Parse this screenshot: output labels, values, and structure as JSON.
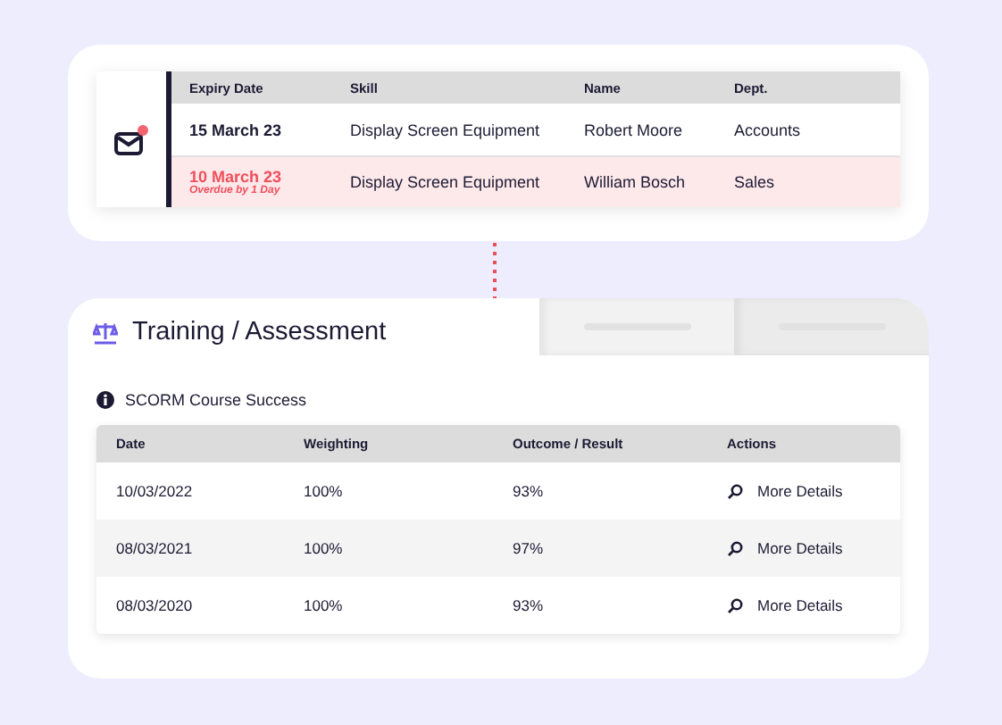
{
  "notification": {
    "unread": true
  },
  "expiry_table": {
    "columns": [
      "Expiry Date",
      "Skill",
      "Name",
      "Dept."
    ],
    "rows": [
      {
        "expiry_date": "15 March 23",
        "skill": "Display Screen Equipment",
        "name": "Robert Moore",
        "dept": "Accounts",
        "overdue": false
      },
      {
        "expiry_date": "10 March 23",
        "note": "Overdue by 1 Day",
        "skill": "Display Screen Equipment",
        "name": "William Bosch",
        "dept": "Sales",
        "overdue": true
      }
    ]
  },
  "panel": {
    "title": "Training / Assessment",
    "section": "SCORM Course Success",
    "columns": [
      "Date",
      "Weighting",
      "Outcome / Result",
      "Actions"
    ],
    "rows": [
      {
        "date": "10/03/2022",
        "weighting": "100%",
        "outcome": "93%",
        "action": "More Details"
      },
      {
        "date": "08/03/2021",
        "weighting": "100%",
        "outcome": "97%",
        "action": "More Details"
      },
      {
        "date": "08/03/2020",
        "weighting": "100%",
        "outcome": "93%",
        "action": "More Details"
      }
    ]
  }
}
